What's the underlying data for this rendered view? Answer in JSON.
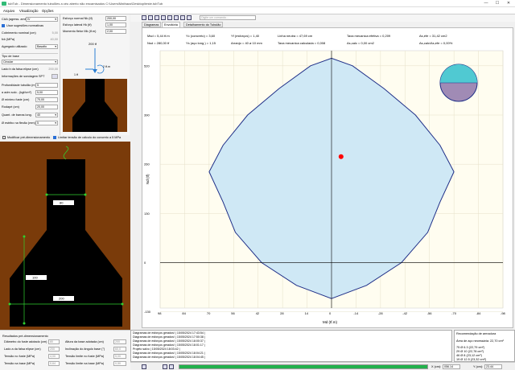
{
  "window": {
    "title": "tubTub - Dimensionamento tubulões a céu aberto não encamisados C:\\Users\\Mathaus\\Desktop\\teste.tubTub",
    "minimize": "—",
    "maximize": "☐",
    "close": "✕"
  },
  "menu": [
    "Arquivo",
    "Visualização",
    "Opções"
  ],
  "inputs": {
    "caa_label": "CAA (agress. ambiental)",
    "caa_value": "IV",
    "normas_label": "Usar sugestões normativas",
    "cobrimento_label": "Cobrimento nominal (cm)",
    "cobrimento_value": "5,00",
    "fck_label": "fck (MPa)",
    "fck_value": "40,00",
    "agregado_label": "Agregado utilizado",
    "agregado_value": "Basalto",
    "base_type_label": "Tipo de base",
    "base_type_value": "Circular",
    "lado_label": "Lado b da falsa elipse (cm)",
    "lado_value": "200,00",
    "spt_label": "Informações de sondagem SPT",
    "prof_label": "Profundidade tubulão (m)",
    "prof_value": "5",
    "atrito_label": "α adm solo - (kgf/cm²)",
    "atrito_value": "5,00",
    "fuste_label": "Ø mínimo fuste (cm)",
    "fuste_value": "70,00",
    "rodape_label": "Rodapé (cm)",
    "rodape_value": "20,00",
    "barras_label": "Quant. de barras long.",
    "barras_value": "40",
    "flexao_label": "Ø estribo na flexão (mm)",
    "flexao_value": "5"
  },
  "esforcos": {
    "nk_label": "Esforço normal Nk (tf)",
    "nk_value": "200,00",
    "hk_label": "Esforço lateral Hk (tf)",
    "hk_value": "1,00",
    "mk_label": "Momento fletor Mk (tf.m)",
    "mk_value": "2,00"
  },
  "preview": {
    "load_label": "200 tf",
    "h_label": "1 tf",
    "m_label": "2 tf.m"
  },
  "options": {
    "modificar_label": "Modificar pré-dimensionamento",
    "limitar_label": "Limitar tensão de cálculo do concreto a 5 MPa"
  },
  "section_dims": {
    "top": "80",
    "bottom": "200",
    "height": "100"
  },
  "results": {
    "title": "Resultados pré-dimensionamento",
    "diam_label": "Diâmetro do fuste adotado (cm)",
    "diam_value": "80",
    "lado_label": "Lado a da falsa elipse (cm)",
    "lado_value": "200",
    "tensao_label": "Tensão no fuste (MPa)",
    "tensao_value": "4,00",
    "tensao_base_label": "Tensão na base (MPa)",
    "tensao_base_value": "0,64",
    "altura_label": "Altura da base adotada (cm)",
    "altura_value": "200",
    "inclinacao_label": "Inclinação do ângulo base (°)",
    "inclinacao_value": "60,0",
    "tensao_lim_label": "Tensão limite no fuste (MPa)",
    "tensao_lim_value": "5,00",
    "tensao_lim_base_label": "Tensão limite na base (MPa)",
    "tensao_lim_base_value": "0,50"
  },
  "toolbar": {
    "search_placeholder": "Digite um comando..."
  },
  "tabs": [
    "Diagramas",
    "Envoltória",
    "Detalhamento do Tubulão"
  ],
  "envelope_info": {
    "nsd": "Msd = 5,44 tf.m",
    "nsd2": "Nsd = 280,00 tf",
    "yc": "Yc (concreto) = 3,60",
    "ys": "Ys (aço long.) = 1,15",
    "yf": "Yf (esforços) = 1,40",
    "arranjo": "Arranjo = 40 ø 10 mm",
    "linha": "Linha neutra = 47,69 cm",
    "taxa_calc": "Taxa mecanica calculada = 0,008",
    "taxa_ef": "Taxa mecanica efetiva = 0,209",
    "as_calc": "As,calc = 0,00 cm2",
    "as_ef": "As,efe = 31,42 cm2",
    "as_ratio": "As,calc/As,efe = 0,00%"
  },
  "chart_data": {
    "type": "area",
    "title": "",
    "xlabel": "Md (tf.m)",
    "ylabel": "Nd (tf)",
    "xlim": [
      98,
      -98
    ],
    "ylim": [
      -120,
      560
    ],
    "x_ticks": [
      "98",
      "84",
      "70",
      "56",
      "42",
      "28",
      "14",
      "0",
      "-14",
      "-28",
      "-42",
      "-56",
      "-70",
      "-84",
      "-98"
    ],
    "y_ticks": [
      "520",
      "390",
      "260",
      "130",
      "0",
      "-130"
    ],
    "envelope": [
      [
        0,
        -95
      ],
      [
        -20,
        -60
      ],
      [
        -40,
        0
      ],
      [
        -55,
        80
      ],
      [
        -62,
        160
      ],
      [
        -70,
        240
      ],
      [
        -62,
        310
      ],
      [
        -48,
        390
      ],
      [
        -30,
        460
      ],
      [
        -12,
        520
      ],
      [
        0,
        540
      ],
      [
        12,
        520
      ],
      [
        30,
        460
      ],
      [
        48,
        390
      ],
      [
        62,
        310
      ],
      [
        70,
        240
      ],
      [
        62,
        160
      ],
      [
        55,
        80
      ],
      [
        40,
        0
      ],
      [
        20,
        -60
      ],
      [
        0,
        -95
      ]
    ],
    "point": [
      -5.44,
      280
    ],
    "colors": {
      "fill": "#cfe8f5",
      "stroke": "#1f2f88",
      "point": "#ff0000"
    }
  },
  "log": [
    "Diagramas de esforços gerados! | 15/05/2024 17:43:54 |",
    "Diagramas de esforços gerados! | 15/05/2024 17:50:38 |",
    "Diagramas de esforços gerados! | 15/05/2024 18:00:37 |",
    "Diagramas de esforços gerados! | 15/05/2024 18:01:17 |",
    "Projeto salvo | 15/05/2024 18:03:42 |",
    "Diagramas de esforços gerados! | 15/05/2024 18:04:21 |",
    "Diagramas de esforços gerados! | 15/05/2024 18:04:45 |"
  ],
  "recommendation": {
    "title": "Recomendação de armadura",
    "area": "Área de aço necessária: 22,70 cm²",
    "lines": [
      "75 Ø 6.3 (22,79 cm²)",
      "29 Ø 10 (22,78 cm²)",
      "46 Ø 8 (23,12 cm²)",
      "19 Ø 12.5 (23,32 cm²)"
    ]
  },
  "status": {
    "x_label": "X (cm):",
    "x_value": "056.14",
    "y_label": "Y (cm):",
    "y_value": "23.44"
  }
}
